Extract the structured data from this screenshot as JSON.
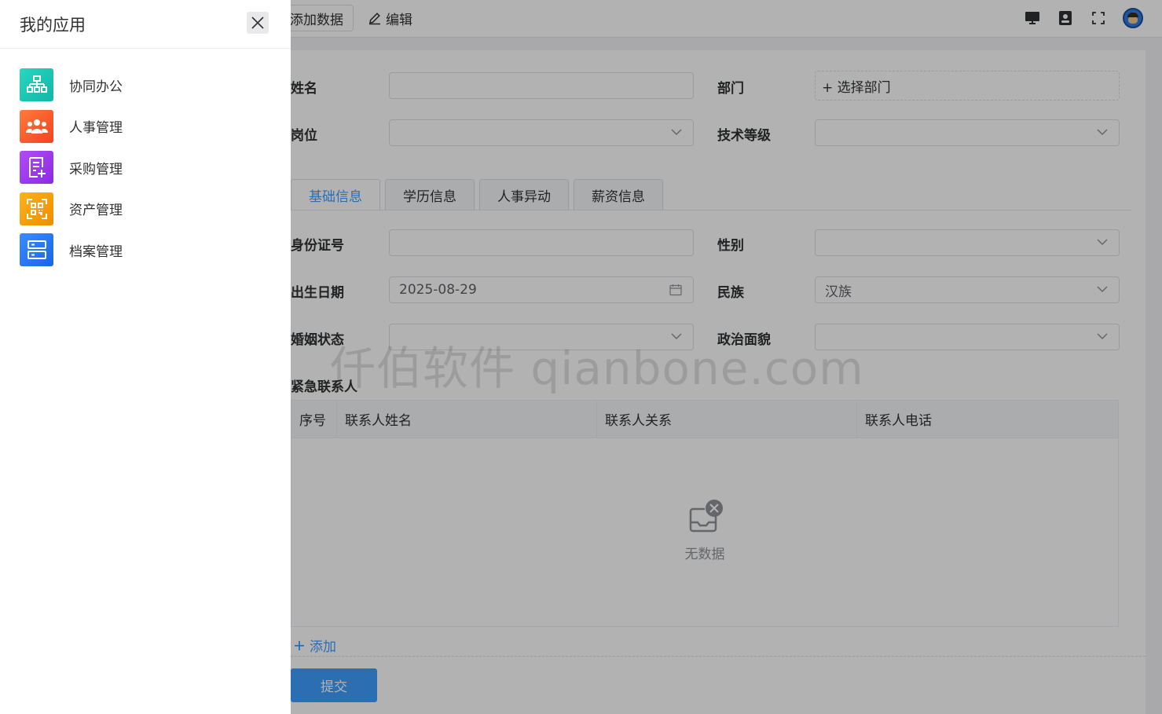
{
  "toolbar": {
    "add_label": "添加数据",
    "edit_label": "编辑"
  },
  "form": {
    "name_label": "姓名",
    "dept_label": "部门",
    "dept_placeholder": "+ 选择部门",
    "post_label": "岗位",
    "tech_level_label": "技术等级",
    "tabs": [
      {
        "label": "基础信息",
        "active": true
      },
      {
        "label": "学历信息",
        "active": false
      },
      {
        "label": "人事异动",
        "active": false
      },
      {
        "label": "薪资信息",
        "active": false
      }
    ],
    "id_card_label": "身份证号",
    "gender_label": "性别",
    "birth_label": "出生日期",
    "birth_value": "2025-08-29",
    "ethnicity_label": "民族",
    "ethnicity_value": "汉族",
    "marital_label": "婚姻状态",
    "political_label": "政治面貌",
    "contacts_title": "紧急联系人",
    "contacts_columns": [
      "序号",
      "联系人姓名",
      "联系人关系",
      "联系人电话"
    ],
    "empty_text": "无数据",
    "add_row_label": "添加",
    "submit_label": "提交"
  },
  "watermark": "仟伯软件 qianbone.com",
  "drawer": {
    "title": "我的应用",
    "apps": [
      {
        "label": "协同办公",
        "icon": "org-chart-icon",
        "color": "#1ec8b4"
      },
      {
        "label": "人事管理",
        "icon": "people-icon",
        "color": "#ff5a2a"
      },
      {
        "label": "采购管理",
        "icon": "purchase-list-icon",
        "color": "#a23cf0"
      },
      {
        "label": "资产管理",
        "icon": "qr-scan-icon",
        "color": "#f5a000"
      },
      {
        "label": "档案管理",
        "icon": "archive-server-icon",
        "color": "#2b7df5"
      }
    ]
  }
}
